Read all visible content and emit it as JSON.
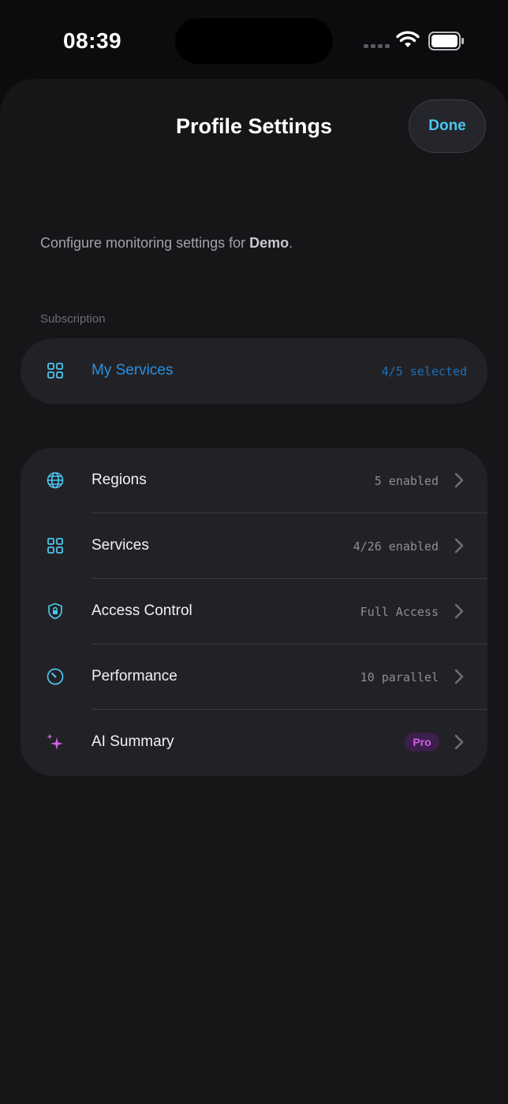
{
  "status_bar": {
    "time": "08:39"
  },
  "header": {
    "title": "Profile Settings",
    "done_label": "Done"
  },
  "description": {
    "prefix": "Configure monitoring settings for ",
    "profile": "Demo",
    "suffix": "."
  },
  "subscription": {
    "section_label": "Subscription",
    "my_services": {
      "label": "My Services",
      "value": "4/5 selected",
      "icon": "grid-icon"
    }
  },
  "settings": {
    "items": [
      {
        "label": "Regions",
        "value": "5 enabled",
        "icon": "globe-icon"
      },
      {
        "label": "Services",
        "value": "4/26 enabled",
        "icon": "grid-icon"
      },
      {
        "label": "Access Control",
        "value": "Full Access",
        "icon": "shield-lock-icon"
      },
      {
        "label": "Performance",
        "value": "10 parallel",
        "icon": "gauge-icon"
      },
      {
        "label": "AI Summary",
        "badge": "Pro",
        "icon": "sparkles-icon"
      }
    ]
  },
  "colors": {
    "accent": "#4cc6ee",
    "link_blue": "#2a8fe0",
    "pro_purple": "#cf5fe8",
    "background": "#161619",
    "card": "#222226"
  }
}
